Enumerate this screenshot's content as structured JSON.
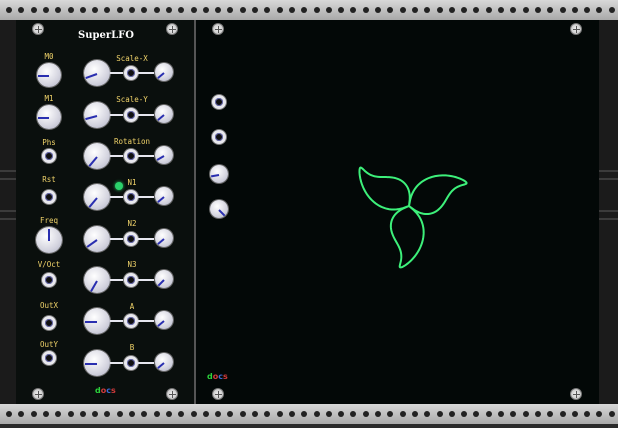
{
  "module": {
    "title": "SuperLFO",
    "labels": {
      "m0": "M0",
      "m1": "M1",
      "phs": "Phs",
      "rst": "Rst",
      "freq": "Freq",
      "voct": "V/Oct",
      "outx": "OutX",
      "outy": "OutY",
      "scale_x": "Scale-X",
      "scale_y": "Scale-Y",
      "rotation": "Rotation",
      "n1": "N1",
      "n2": "N2",
      "n3": "N3",
      "a": "A",
      "b": "B"
    },
    "logo": {
      "d": "d",
      "o": "o",
      "c": "c",
      "d2": "s"
    }
  },
  "display": {
    "logo": {
      "d": "d",
      "o": "o",
      "c": "c",
      "d2": "s"
    }
  },
  "colors": {
    "label": "#f0d36a",
    "trace": "#3df07a",
    "knob_pointer": "#2a2fb0",
    "led": "#2bd16b"
  }
}
